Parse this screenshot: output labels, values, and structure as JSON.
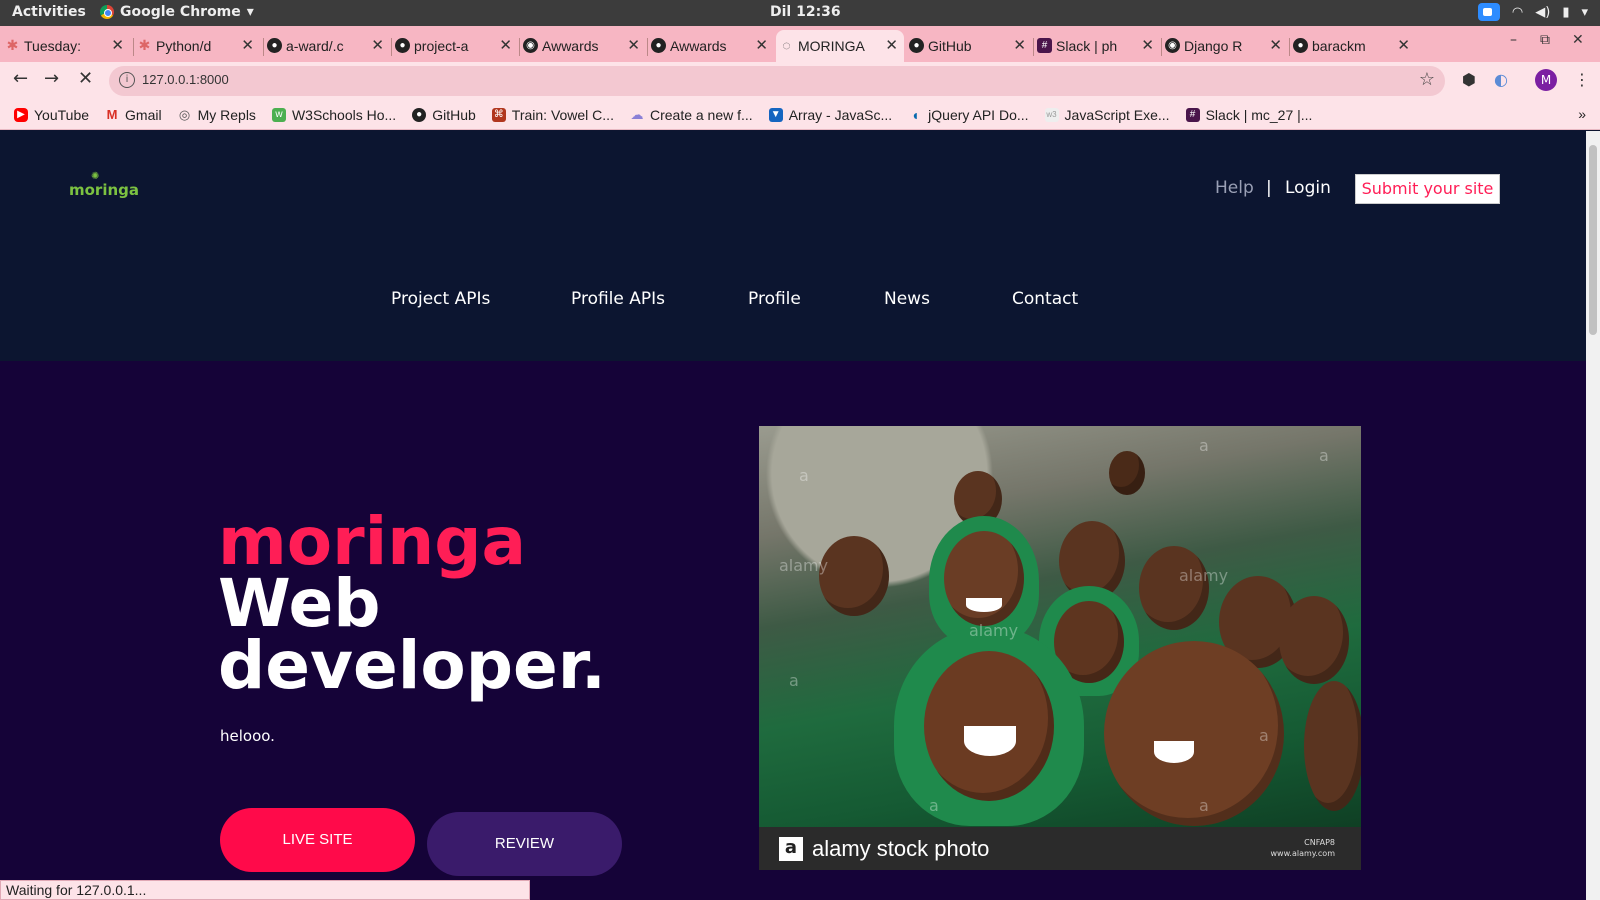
{
  "system_bar": {
    "activities": "Activities",
    "app": "Google Chrome",
    "clock": "Dil 12:36"
  },
  "tabs": [
    {
      "title": "Tuesday:",
      "icon": "palm-icon"
    },
    {
      "title": "Python/d",
      "icon": "palm-icon"
    },
    {
      "title": "a-ward/.c",
      "icon": "github-icon"
    },
    {
      "title": "project-a",
      "icon": "github-icon"
    },
    {
      "title": "Awwards",
      "icon": "globe-icon"
    },
    {
      "title": "Awwards",
      "icon": "github-icon"
    },
    {
      "title": "MORINGA",
      "icon": "loading-icon",
      "active": true
    },
    {
      "title": "GitHub",
      "icon": "github-icon"
    },
    {
      "title": "Slack | ph",
      "icon": "slack-icon"
    },
    {
      "title": "Django R",
      "icon": "globe-icon"
    },
    {
      "title": "barackm",
      "icon": "github-icon"
    }
  ],
  "toolbar": {
    "url": "127.0.0.1:8000",
    "profile_initial": "M"
  },
  "bookmarks": [
    {
      "label": "YouTube",
      "color": "#ff0000"
    },
    {
      "label": "Gmail",
      "color": "#d93025"
    },
    {
      "label": "My Repls",
      "color": "#555555"
    },
    {
      "label": "W3Schools Ho...",
      "color": "#4caf50"
    },
    {
      "label": "GitHub",
      "color": "#222222"
    },
    {
      "label": "Train: Vowel C...",
      "color": "#b1361e"
    },
    {
      "label": "Create a new f...",
      "color": "#8a7fd6"
    },
    {
      "label": "Array - JavaSc...",
      "color": "#1565c0"
    },
    {
      "label": "jQuery API Do...",
      "color": "#0769ad"
    },
    {
      "label": "JavaScript Exe...",
      "color": "#bbbbbb"
    },
    {
      "label": "Slack | mc_27 |...",
      "color": "#4a154b"
    }
  ],
  "site": {
    "logo": "moringa",
    "help": "Help",
    "separator": "|",
    "login": "Login",
    "submit": "Submit your site",
    "nav": [
      "Project APIs",
      "Profile APIs",
      "Profile",
      "News",
      "Contact"
    ],
    "hero": {
      "line1": "moringa",
      "line2": "Web",
      "line3": "developer.",
      "subtitle": "helooo.",
      "btn_live": "LIVE SITE",
      "btn_review": "REVIEW"
    },
    "photo": {
      "brand_letter": "a",
      "brand_text": "alamy stock photo",
      "code": "CNFAP8",
      "site": "www.alamy.com",
      "watermark": "alamy",
      "watermark_letter": "a"
    }
  },
  "status_text": "Waiting for 127.0.0.1...",
  "colors": {
    "accent": "#ff1e56",
    "header_bg": "#0c1530",
    "hero_bg": "#150338",
    "review_btn": "#3a1b6b",
    "tabbar": "#f7b6c3"
  }
}
